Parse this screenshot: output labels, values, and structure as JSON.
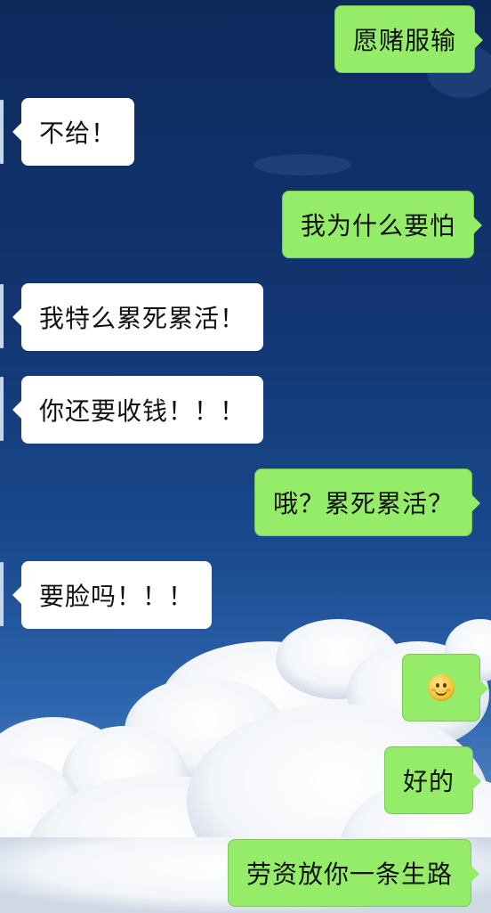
{
  "chat": {
    "messages": [
      {
        "id": "m1",
        "side": "outgoing",
        "text": "愿赌服输"
      },
      {
        "id": "m2",
        "side": "incoming",
        "text": "不给！"
      },
      {
        "id": "m3",
        "side": "outgoing",
        "text": "我为什么要怕"
      },
      {
        "id": "m4",
        "side": "incoming",
        "text": "我特么累死累活！"
      },
      {
        "id": "m5",
        "side": "incoming",
        "text": "你还要收钱！！！"
      },
      {
        "id": "m6",
        "side": "outgoing",
        "text": "哦？累死累活？"
      },
      {
        "id": "m7",
        "side": "incoming",
        "text": "要脸吗！！！"
      },
      {
        "id": "m8",
        "side": "outgoing",
        "emoji": "smile-emoji"
      },
      {
        "id": "m9",
        "side": "outgoing",
        "text": "好的"
      },
      {
        "id": "m10",
        "side": "outgoing",
        "text": "劳资放你一条生路"
      }
    ]
  },
  "colors": {
    "outgoing_bubble": "#95ec69",
    "incoming_bubble": "#ffffff",
    "sky": "#123572"
  }
}
